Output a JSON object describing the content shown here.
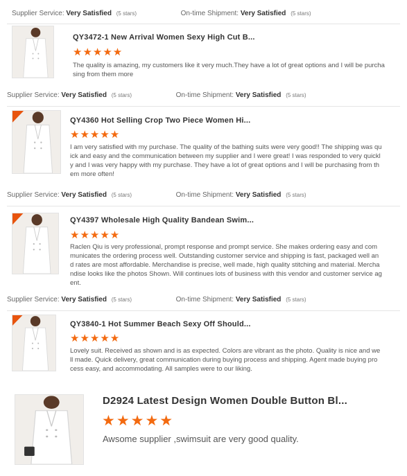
{
  "ratings_labels": {
    "supplier": "Supplier Service:",
    "shipment": "On-time Shipment:",
    "value": "Very Satisfied",
    "stars": "(5 stars)"
  },
  "star_glyphs": "★★★★★",
  "colors": {
    "star": "#f36a10",
    "text": "#333333",
    "muted": "#666666"
  },
  "reviews": [
    {
      "title": "QY3472-1 New Arrival Women Sexy High Cut B...",
      "rating": 5,
      "text": "The quality is amazing, my customers like it very much.They have a lot of great options and I will be purchasing from them more"
    },
    {
      "title": "QY4360 Hot Selling Crop Two Piece Women Hi...",
      "rating": 5,
      "text": "I am very satisfied with my purchase. The quality of the bathing suits were very good!! The shipping was quick and easy and the communication between my supplier and I were great! I was responded to very quickly and I was very happy with my purchase. They have a lot of great options and I will be purchasing from them more often!"
    },
    {
      "title": "QY4397 Wholesale High Quality Bandean Swim...",
      "rating": 5,
      "text": "Raclen Qiu is very professional, prompt response and prompt service. She makes ordering easy and communicates the ordering process well. Outstanding customer service and shipping is fast, packaged well and rates are most affordable. Merchandise is precise, well made, high quality stitching and material. Merchandise looks like the photos Shown. Will continues lots of business with this vendor and customer service agent."
    },
    {
      "title": "QY3840-1 Hot Summer Beach Sexy Off Should...",
      "rating": 5,
      "text": "Lovely suit. Received as shown and is as expected. Colors are vibrant as the photo.  Quality is nice and well made. Quick delivery, great communication during buying process and shipping. Agent made buying process easy, and accommodating. All samples were to our liking."
    },
    {
      "title": "D2924 Latest Design Women Double Button Bl...",
      "rating": 5,
      "text": "Awsome supplier ,swimsuit are very good quality."
    }
  ]
}
